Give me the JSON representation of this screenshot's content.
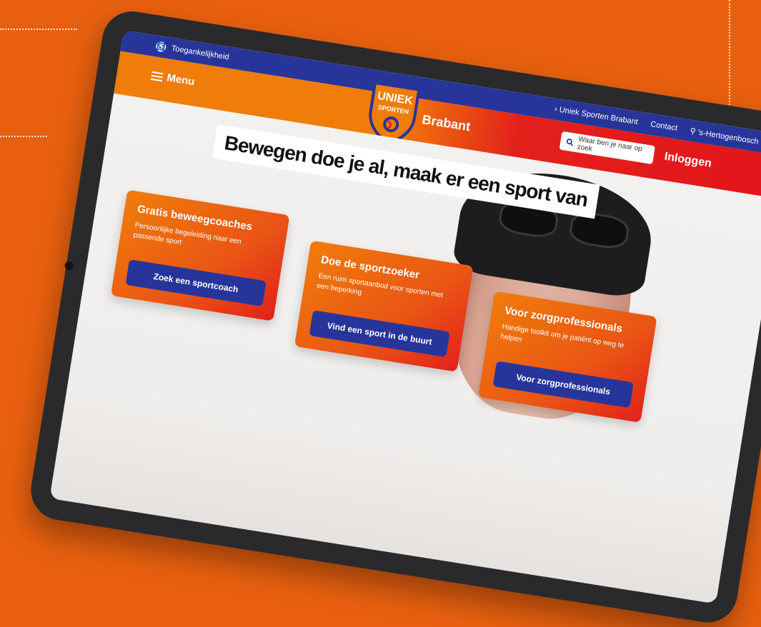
{
  "topbar": {
    "accessibility_label": "Toegankelijkheid",
    "crumb_label": "Uniek Sporten Brabant",
    "contact_label": "Contact",
    "location_label": "'s-Hertogenbosch"
  },
  "navbar": {
    "menu_label": "Menu",
    "logo_line1": "UNIEK",
    "logo_line2": "SPORTEN",
    "brand_label": "Brabant",
    "search_placeholder": "Waar ben je naar op zoek",
    "login_label": "Inloggen"
  },
  "hero": {
    "headline": "Bewegen doe je al, maak er een sport van"
  },
  "cards": [
    {
      "title": "Gratis beweegcoaches",
      "text": "Persoonlijke begeleiding naar een passende sport",
      "button": "Zoek een sportcoach"
    },
    {
      "title": "Doe de sportzoeker",
      "text": "Een ruim sportaanbod voor sporten met een beperking",
      "button": "Vind een sport in de buurt"
    },
    {
      "title": "Voor zorgprofessionals",
      "text": "Handige toolkit om je patiënt op weg te helpen",
      "button": "Voor zorgprofessionals"
    }
  ],
  "colors": {
    "orange": "#e8600f",
    "navy": "#27359a",
    "red": "#e3211b"
  }
}
